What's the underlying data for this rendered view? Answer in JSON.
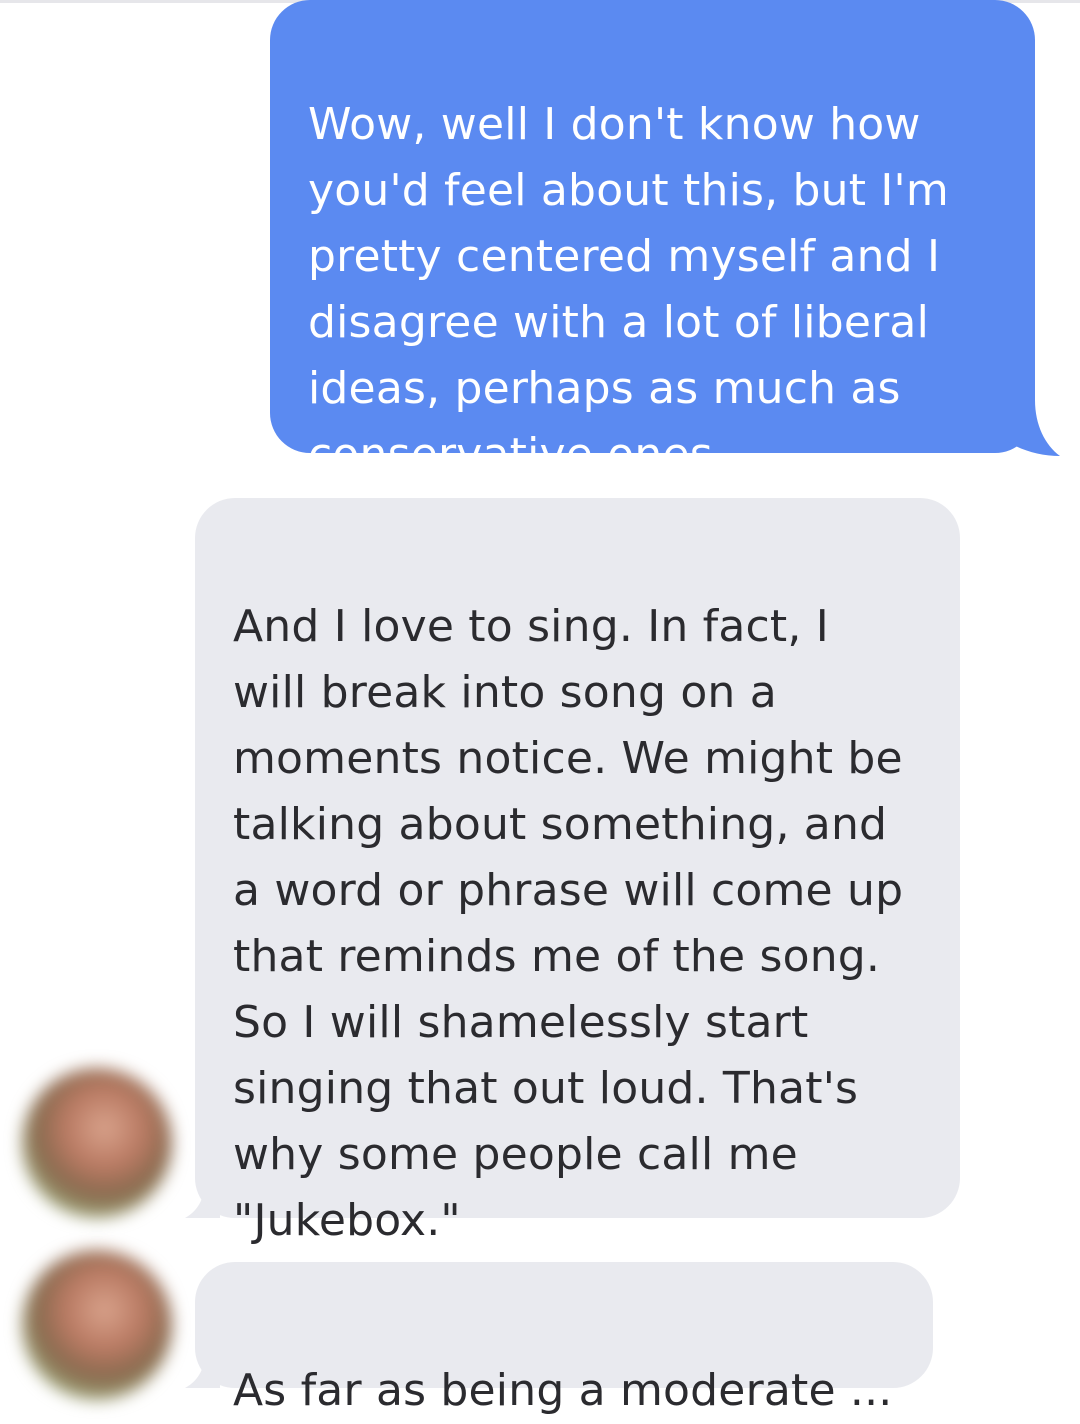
{
  "conversation": {
    "messages": [
      {
        "direction": "outgoing",
        "text": "Wow, well I don't know how\nyou'd feel about this, but I'm\npretty centered myself and I\ndisagree with a lot of liberal\nideas, perhaps as much as\nconservative ones"
      },
      {
        "direction": "incoming",
        "text": "And I love to sing. In fact, I\nwill break into song on a\nmoments notice. We might be\ntalking about something, and\na word or phrase will come up\nthat reminds me of the song.\nSo I will shamelessly start\nsinging that out loud. That's\nwhy some people call me\n\"Jukebox.\""
      },
      {
        "direction": "incoming",
        "text": "As far as being a moderate ..."
      }
    ]
  },
  "colors": {
    "outgoing_bubble": "#5b8af1",
    "incoming_bubble": "#e9eaef",
    "outgoing_text": "#ffffff",
    "incoming_text": "#2b2b2f"
  },
  "icons": {
    "avatar": "blurred-profile-photo"
  }
}
